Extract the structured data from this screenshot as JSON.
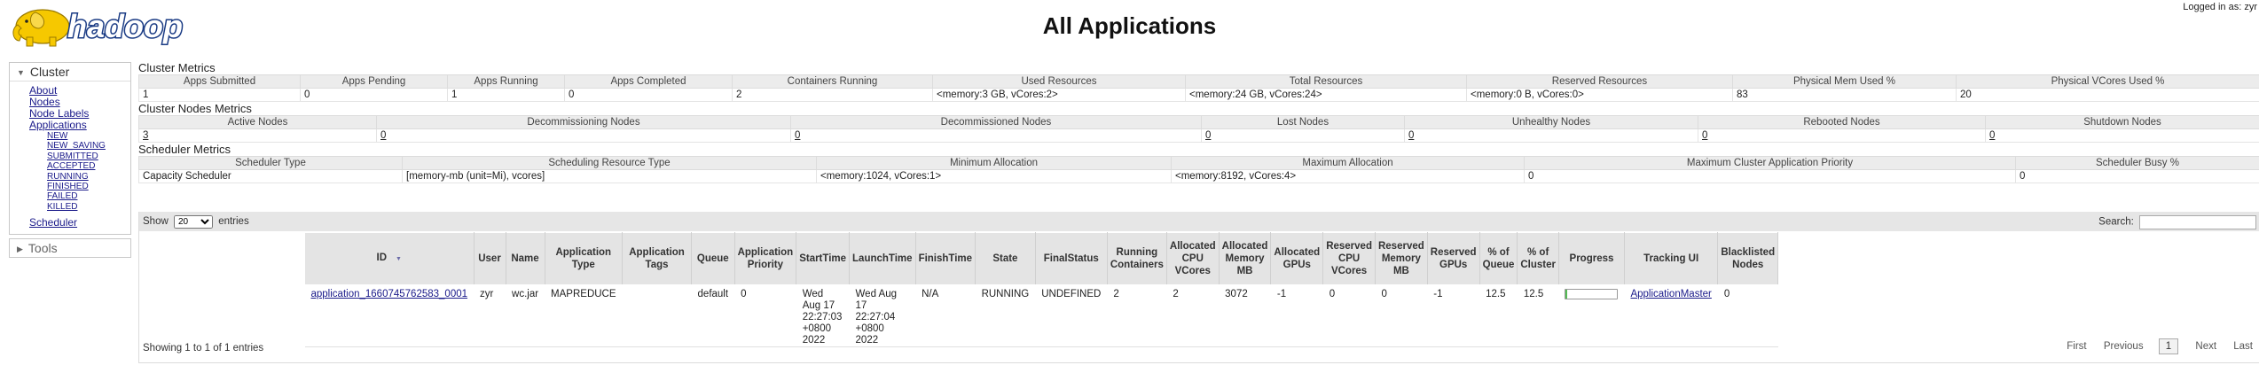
{
  "header": {
    "logo_text": "hadoop",
    "title": "All Applications",
    "login": "Logged in as: zyr"
  },
  "nav": {
    "cluster_label": "Cluster",
    "links": [
      "About",
      "Nodes",
      "Node Labels",
      "Applications"
    ],
    "app_states": [
      "NEW",
      "NEW_SAVING",
      "SUBMITTED",
      "ACCEPTED",
      "RUNNING",
      "FINISHED",
      "FAILED",
      "KILLED"
    ],
    "scheduler": "Scheduler",
    "tools_label": "Tools"
  },
  "cluster_metrics": {
    "title": "Cluster Metrics",
    "headers": [
      "Apps Submitted",
      "Apps Pending",
      "Apps Running",
      "Apps Completed",
      "Containers Running",
      "Used Resources",
      "Total Resources",
      "Reserved Resources",
      "Physical Mem Used %",
      "Physical VCores Used %"
    ],
    "values": [
      "1",
      "0",
      "1",
      "0",
      "2",
      "<memory:3 GB, vCores:2>",
      "<memory:24 GB, vCores:24>",
      "<memory:0 B, vCores:0>",
      "83",
      "20"
    ]
  },
  "nodes_metrics": {
    "title": "Cluster Nodes Metrics",
    "headers": [
      "Active Nodes",
      "Decommissioning Nodes",
      "Decommissioned Nodes",
      "Lost Nodes",
      "Unhealthy Nodes",
      "Rebooted Nodes",
      "Shutdown Nodes"
    ],
    "values": [
      "3",
      "0",
      "0",
      "0",
      "0",
      "0",
      "0"
    ]
  },
  "scheduler_metrics": {
    "title": "Scheduler Metrics",
    "headers": [
      "Scheduler Type",
      "Scheduling Resource Type",
      "Minimum Allocation",
      "Maximum Allocation",
      "Maximum Cluster Application Priority",
      "Scheduler Busy %"
    ],
    "values": [
      "Capacity Scheduler",
      "[memory-mb (unit=Mi), vcores]",
      "<memory:1024, vCores:1>",
      "<memory:8192, vCores:4>",
      "0",
      "0"
    ]
  },
  "apps_table": {
    "show_label": "Show",
    "entries_label": "entries",
    "page_size": "20",
    "search_label": "Search:",
    "search_value": "",
    "columns": [
      "ID",
      "User",
      "Name",
      "Application Type",
      "Application Tags",
      "Queue",
      "Application Priority",
      "StartTime",
      "LaunchTime",
      "FinishTime",
      "State",
      "FinalStatus",
      "Running Containers",
      "Allocated CPU VCores",
      "Allocated Memory MB",
      "Allocated GPUs",
      "Reserved CPU VCores",
      "Reserved Memory MB",
      "Reserved GPUs",
      "% of Queue",
      "% of Cluster",
      "Progress",
      "Tracking UI",
      "Blacklisted Nodes"
    ],
    "rows": [
      {
        "id": "application_1660745762583_0001",
        "user": "zyr",
        "name": "wc.jar",
        "type": "MAPREDUCE",
        "tags": "",
        "queue": "default",
        "priority": "0",
        "start": "Wed Aug 17 22:27:03 +0800 2022",
        "launch": "Wed Aug 17 22:27:04 +0800 2022",
        "finish": "N/A",
        "state": "RUNNING",
        "final": "UNDEFINED",
        "running": "2",
        "cpu": "2",
        "mem": "3072",
        "gpus": "-1",
        "rcpu": "0",
        "rmem": "0",
        "rgpus": "-1",
        "pqueue": "12.5",
        "pcluster": "12.5",
        "progress": 0.03,
        "tracking": "ApplicationMaster",
        "blacklisted": "0"
      }
    ],
    "info": "Showing 1 to 1 of 1 entries",
    "pager": {
      "first": "First",
      "previous": "Previous",
      "current": "1",
      "next": "Next",
      "last": "Last"
    }
  },
  "colors": {
    "link": "#1a1a8a",
    "header_bg": "#e4e4e4",
    "progress_fill": "#55bb55"
  }
}
